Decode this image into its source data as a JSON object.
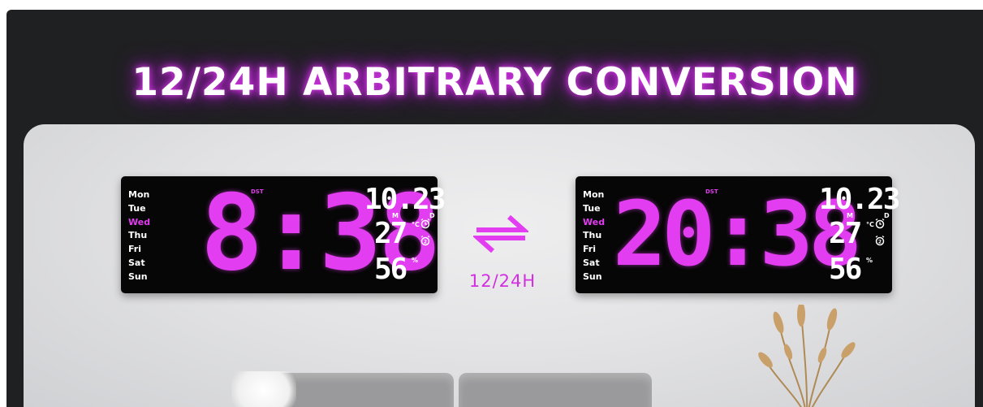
{
  "headline": "12/24H ARBITRARY CONVERSION",
  "conversion_label": "12/24H",
  "colors": {
    "accent": "#e33df2",
    "background": "#1f2022",
    "display_bg": "#060606",
    "segment_white": "#ffffff"
  },
  "clocks": [
    {
      "mode": "12H",
      "days": [
        "Mon",
        "Tue",
        "Wed",
        "Thu",
        "Fri",
        "Sat",
        "Sun"
      ],
      "active_day": "Wed",
      "dst_label": "DST",
      "time": "8:38",
      "date": "10.23",
      "month_marker": "M",
      "day_marker": "D",
      "temperature": "27",
      "temp_unit": "°C",
      "humidity": "56",
      "humidity_unit": "%",
      "icons": [
        "alarm-clock-icon",
        "alarm-clock-icon"
      ]
    },
    {
      "mode": "24H",
      "days": [
        "Mon",
        "Tue",
        "Wed",
        "Thu",
        "Fri",
        "Sat",
        "Sun"
      ],
      "active_day": "Wed",
      "dst_label": "DST",
      "time": "20:38",
      "date": "10.23",
      "month_marker": "M",
      "day_marker": "D",
      "temperature": "27",
      "temp_unit": "°C",
      "humidity": "56",
      "humidity_unit": "%",
      "icons": [
        "alarm-clock-icon",
        "alarm-clock-icon"
      ]
    }
  ],
  "swap_icon": "swap-arrows-icon"
}
